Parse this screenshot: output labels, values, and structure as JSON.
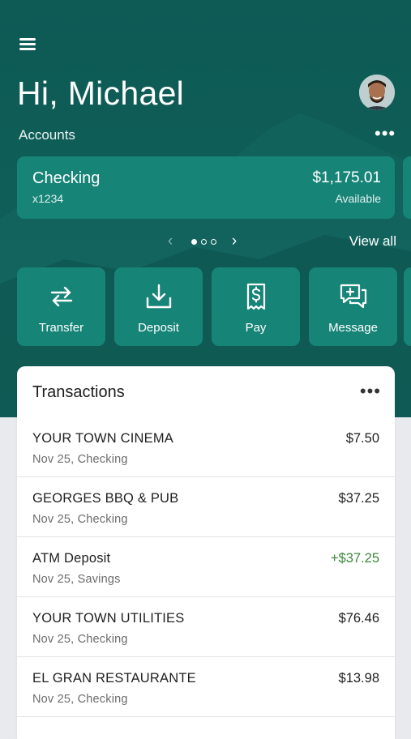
{
  "header": {
    "greeting": "Hi, Michael",
    "menu_icon": "hamburger-menu-icon",
    "avatar_icon": "user-avatar"
  },
  "accounts": {
    "label": "Accounts",
    "more_icon": "more-horizontal-icon",
    "card": {
      "name": "Checking",
      "number": "x1234",
      "balance": "$1,175.01",
      "balance_label": "Available"
    },
    "pager": {
      "total_pages": 3,
      "active_page": 1
    },
    "view_all": "View all"
  },
  "actions": [
    {
      "label": "Transfer",
      "icon": "transfer-arrows-icon"
    },
    {
      "label": "Deposit",
      "icon": "download-tray-icon"
    },
    {
      "label": "Pay",
      "icon": "dollar-receipt-icon"
    },
    {
      "label": "Message",
      "icon": "message-plus-icon"
    }
  ],
  "transactions": {
    "title": "Transactions",
    "items": [
      {
        "description": "YOUR TOWN CINEMA",
        "detail": "Nov 25, Checking",
        "amount": "$7.50",
        "credit": false
      },
      {
        "description": "GEORGES BBQ & PUB",
        "detail": "Nov 25, Checking",
        "amount": "$37.25",
        "credit": false
      },
      {
        "description": "ATM Deposit",
        "detail": "Nov 25, Savings",
        "amount": "+$37.25",
        "credit": true
      },
      {
        "description": "YOUR TOWN UTILITIES",
        "detail": "Nov 25, Checking",
        "amount": "$76.46",
        "credit": false
      },
      {
        "description": "EL GRAN RESTAURANTE",
        "detail": "Nov 25, Checking",
        "amount": "$13.98",
        "credit": false
      }
    ]
  },
  "colors": {
    "header_bg": "#0f5d57",
    "card_bg": "#178478",
    "credit_text": "#3b8a3b",
    "page_bg": "#e8eaee"
  }
}
